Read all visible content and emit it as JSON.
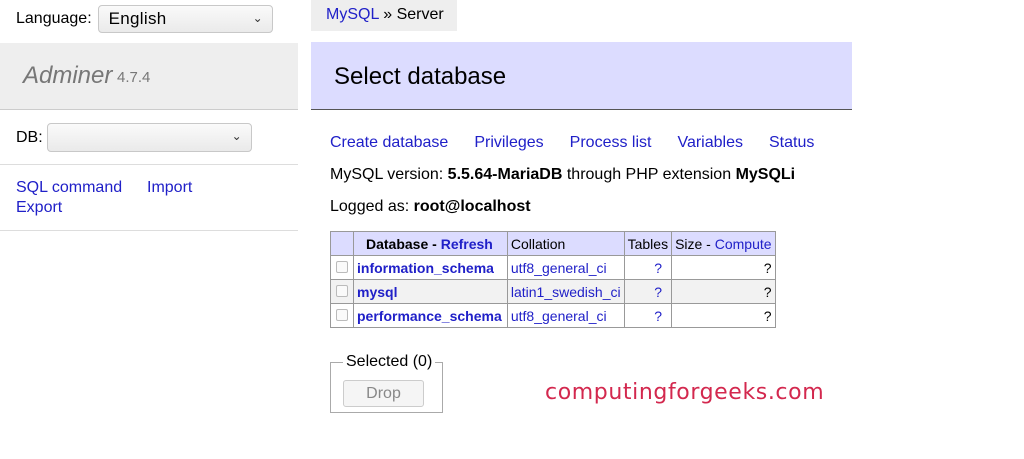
{
  "sidebar": {
    "language_label": "Language:",
    "language_value": "English",
    "app_name": "Adminer",
    "app_version": "4.7.4",
    "db_label": "DB:",
    "db_value": "",
    "links": {
      "sql_command": "SQL command",
      "import": "Import",
      "export": "Export"
    }
  },
  "breadcrumb": {
    "driver": "MySQL",
    "separator": "»",
    "current": "Server"
  },
  "header": {
    "title": "Select database"
  },
  "nav_links": [
    "Create database",
    "Privileges",
    "Process list",
    "Variables",
    "Status"
  ],
  "info": {
    "version_prefix": "MySQL version:",
    "version": "5.5.64-MariaDB",
    "version_mid": "through PHP extension",
    "extension": "MySQLi",
    "logged_prefix": "Logged as:",
    "user": "root@localhost"
  },
  "table": {
    "headers": {
      "database": "Database",
      "dash": " - ",
      "refresh": "Refresh",
      "collation": "Collation",
      "tables": "Tables",
      "size": "Size",
      "compute": "Compute"
    },
    "rows": [
      {
        "name": "information_schema",
        "collation": "utf8_general_ci",
        "tables": "?",
        "size": "?"
      },
      {
        "name": "mysql",
        "collation": "latin1_swedish_ci",
        "tables": "?",
        "size": "?"
      },
      {
        "name": "performance_schema",
        "collation": "utf8_general_ci",
        "tables": "?",
        "size": "?"
      }
    ]
  },
  "selected": {
    "legend": "Selected (0)",
    "drop_label": "Drop"
  },
  "watermark": "computingforgeeks.com",
  "colors": {
    "link": "#2020c8",
    "header_bg": "#dcdcff",
    "watermark": "#d3284e"
  }
}
